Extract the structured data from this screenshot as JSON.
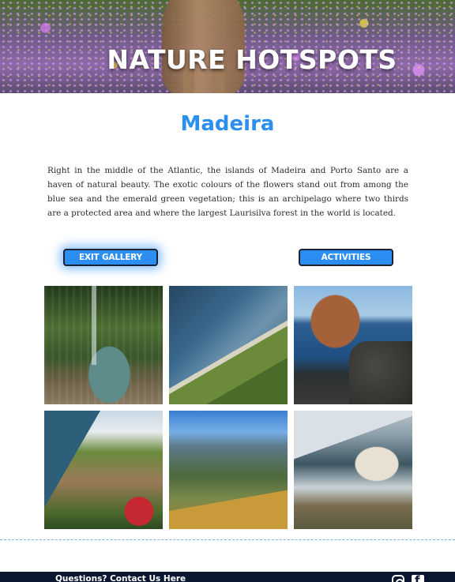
{
  "hero": {
    "title": "NATURE HOTSPOTS"
  },
  "page": {
    "title": "Madeira",
    "intro": "Right in the middle of the Atlantic, the islands of Madeira and Porto Santo are a haven of natural beauty. The exotic colours of the flowers stand out from among the blue sea and the emerald green vegetation; this is an archipelago where two thirds are a protected area and where the largest Laurisilva forest in the world is located."
  },
  "buttons": {
    "exit_gallery": "EXIT GALLERY",
    "activities": "ACTIVITIES"
  },
  "gallery": {
    "photos": [
      {
        "subject": "waterfall-pool"
      },
      {
        "subject": "coastal-cliff-aerial"
      },
      {
        "subject": "rock-islet-sea"
      },
      {
        "subject": "hillside-village"
      },
      {
        "subject": "mountain-valley"
      },
      {
        "subject": "cliff-village-sea"
      }
    ]
  },
  "footer": {
    "contact_link": "Questions? Contact Us Here",
    "social_icons": [
      "instagram-icon",
      "facebook-icon"
    ]
  },
  "colors": {
    "accent": "#2b8ff0",
    "button_bg": "#2c8df2",
    "footer_bg": "#0b1630"
  }
}
